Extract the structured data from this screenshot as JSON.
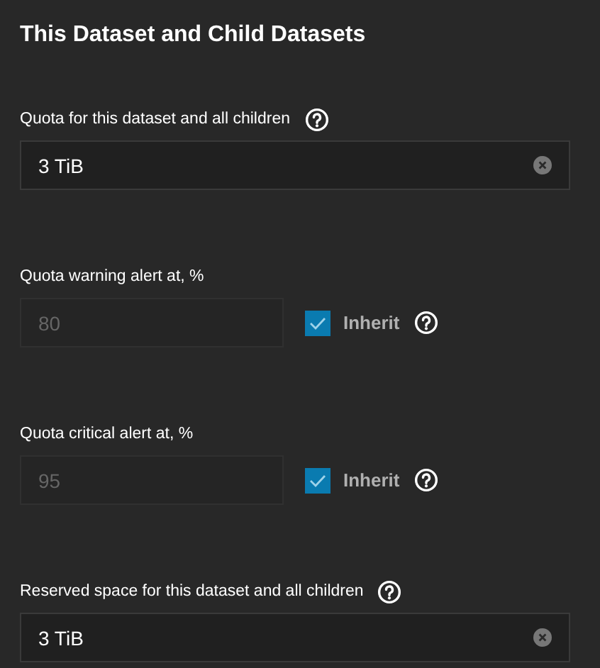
{
  "title": "This Dataset and Child Datasets",
  "fields": [
    {
      "kind": "text",
      "label": "Quota for this dataset and all children",
      "help": true,
      "value": "3 TiB",
      "disabled": false
    },
    {
      "kind": "percent",
      "label": "Quota warning alert at, %",
      "help": false,
      "value": "80",
      "disabled": true,
      "inherit": {
        "label": "Inherit",
        "checked": true
      }
    },
    {
      "kind": "percent",
      "label": "Quota critical alert at, %",
      "help": false,
      "value": "95",
      "disabled": true,
      "inherit": {
        "label": "Inherit",
        "checked": true
      }
    },
    {
      "kind": "text",
      "label": "Reserved space for this dataset and all children",
      "help": true,
      "value": "3 TiB",
      "disabled": false
    }
  ]
}
